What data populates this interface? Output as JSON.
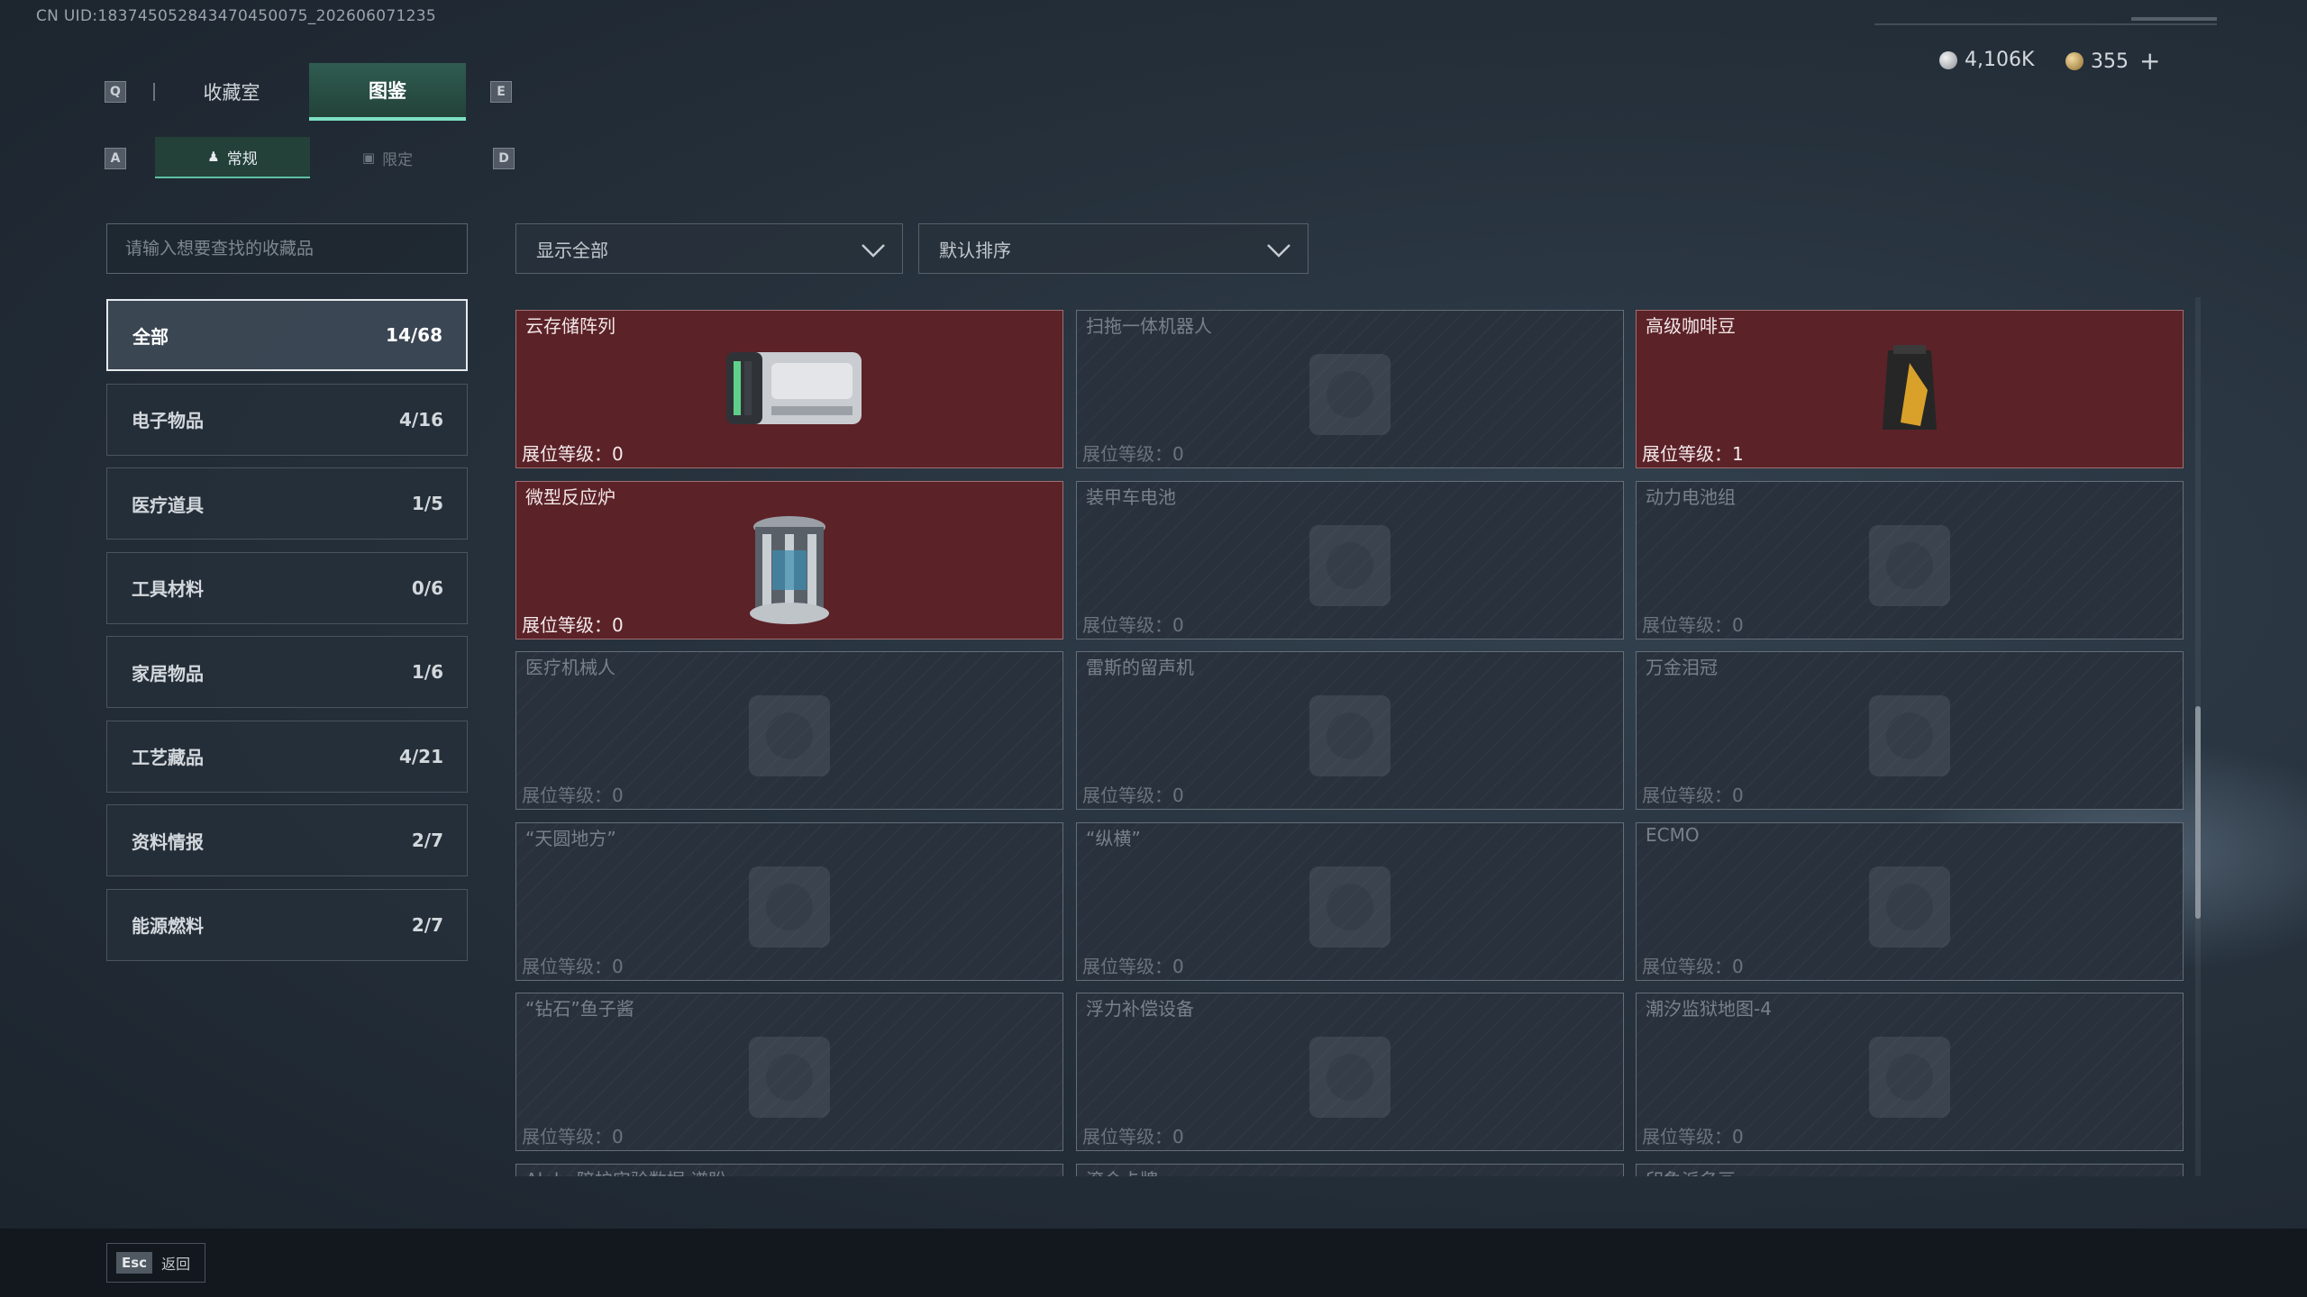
{
  "header": {
    "uid_text": "CN UID:1837450528434704500​75_202606071235",
    "currency": [
      {
        "icon": "silver-coin-icon",
        "value": "4,106K"
      },
      {
        "icon": "gold-coin-icon",
        "value": "355"
      }
    ],
    "plus_symbol": "+"
  },
  "tabs": {
    "main": [
      {
        "label": "收藏室",
        "active": false
      },
      {
        "label": "图鉴",
        "active": true
      }
    ],
    "main_keys": [
      "Q",
      "E"
    ],
    "sub": [
      {
        "label": "常规",
        "icon": "figure-icon",
        "active": true
      },
      {
        "label": "限定",
        "icon": "image-icon",
        "active": false
      }
    ],
    "sub_keys": [
      "A",
      "D"
    ]
  },
  "search": {
    "placeholder": "请输入想要查找的收藏品"
  },
  "filters": {
    "show": "显示全部",
    "sort": "默认排序"
  },
  "categories": [
    {
      "label": "全部",
      "count": "14/68",
      "active": true
    },
    {
      "label": "电子物品",
      "count": "4/16"
    },
    {
      "label": "医疗道具",
      "count": "1/5"
    },
    {
      "label": "工具材料",
      "count": "0/6"
    },
    {
      "label": "家居物品",
      "count": "1/6"
    },
    {
      "label": "工艺藏品",
      "count": "4/21"
    },
    {
      "label": "资料情报",
      "count": "2/7"
    },
    {
      "label": "能源燃料",
      "count": "2/7"
    }
  ],
  "level_prefix": "展位等级：",
  "items": [
    {
      "name": "云存储阵列",
      "level": "0",
      "owned": true,
      "icon": "storage-array-icon"
    },
    {
      "name": "扫拖一体机器人",
      "level": "0",
      "owned": false,
      "icon": "cleaning-robot-icon"
    },
    {
      "name": "高级咖啡豆",
      "level": "1",
      "owned": true,
      "icon": "coffee-bag-icon"
    },
    {
      "name": "微型反应炉",
      "level": "0",
      "owned": true,
      "icon": "reactor-icon"
    },
    {
      "name": "装甲车电池",
      "level": "0",
      "owned": false,
      "icon": "battery-icon"
    },
    {
      "name": "动力电池组",
      "level": "0",
      "owned": false,
      "icon": "battery-pack-icon"
    },
    {
      "name": "医疗机械人",
      "level": "0",
      "owned": false,
      "icon": "medical-robot-icon"
    },
    {
      "name": "雷斯的留声机",
      "level": "0",
      "owned": false,
      "icon": "gramophone-icon"
    },
    {
      "name": "万金泪冠",
      "level": "0",
      "owned": false,
      "icon": "crown-icon"
    },
    {
      "name": "“天圆地方”",
      "level": "0",
      "owned": false,
      "icon": "armillary-icon"
    },
    {
      "name": "“纵横”",
      "level": "0",
      "owned": false,
      "icon": "chessboard-icon"
    },
    {
      "name": "ECMO",
      "level": "0",
      "owned": false,
      "icon": "ecmo-icon"
    },
    {
      "name": "“钻石”鱼子酱",
      "level": "0",
      "owned": false,
      "icon": "caviar-tin-icon"
    },
    {
      "name": "浮力补偿设备",
      "level": "0",
      "owned": false,
      "icon": "buoyancy-device-icon"
    },
    {
      "name": "潮汐监狱地图-4",
      "level": "0",
      "owned": false,
      "icon": "map-icon"
    },
    {
      "name": "Alpha陪护实验数据 谱盼",
      "level": "",
      "owned": false,
      "icon": "data-icon"
    },
    {
      "name": "滚合卡牌",
      "level": "",
      "owned": false,
      "icon": "card-icon"
    },
    {
      "name": "印象派名画",
      "level": "",
      "owned": false,
      "icon": "painting-icon"
    }
  ],
  "footer": {
    "key": "Esc",
    "label": "返回"
  }
}
